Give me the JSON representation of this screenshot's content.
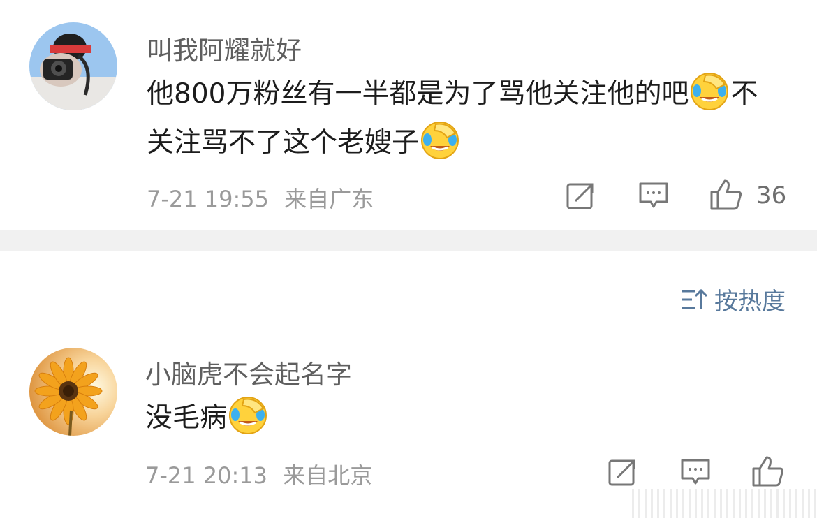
{
  "comments": [
    {
      "username": "叫我阿耀就好",
      "text_parts": [
        "他800万粉丝有一半都是为了骂他关注他的吧",
        "不关注骂不了这个老嫂子"
      ],
      "time": "7-21 19:55",
      "location": "来自广东",
      "like_count": "36",
      "avatar_icon": "photographer-avatar",
      "emoji": "laughing-crying-emoji"
    },
    {
      "username": "小脑虎不会起名字",
      "text_parts": [
        "没毛病"
      ],
      "time": "7-21 20:13",
      "location": "来自北京",
      "avatar_icon": "sunflower-avatar",
      "emoji": "laughing-crying-emoji"
    }
  ],
  "sort": {
    "label": "按热度",
    "icon": "sort-icon"
  },
  "colors": {
    "link": "#58799c",
    "separator": "#f1f1f1",
    "meta": "#9a9a9a"
  }
}
